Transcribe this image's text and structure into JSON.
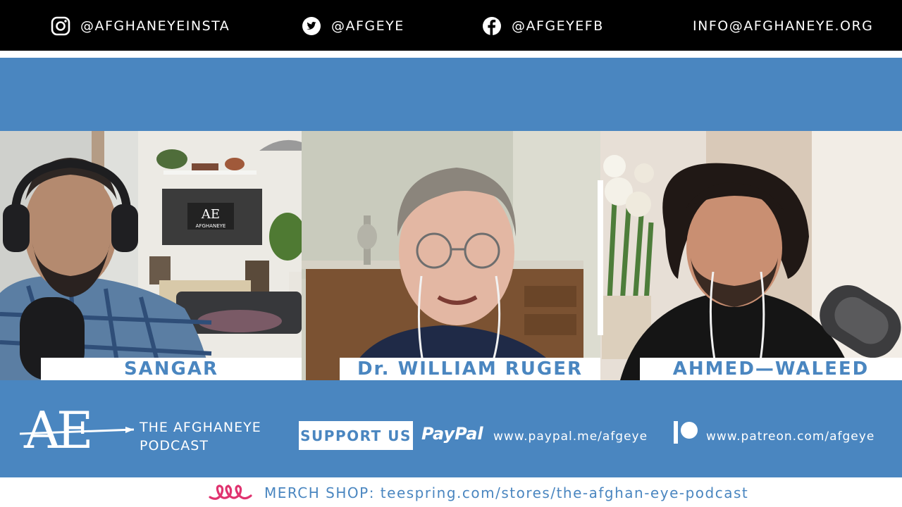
{
  "social": {
    "instagram": "@AFGHANEYEINSTA",
    "twitter": "@AFGEYE",
    "facebook": "@AFGEYEFB",
    "email": "INFO@AFGHANEYE.ORG"
  },
  "participants": [
    {
      "name": "SANGAR"
    },
    {
      "name": "Dr. WILLIAM RUGER"
    },
    {
      "name": "AHMED—WALEED"
    }
  ],
  "background_tv": {
    "logo": "AE",
    "label": "AFGHANEYE"
  },
  "banner": {
    "logo_text": "AE",
    "podcast_line1": "THE AFGHANEYE",
    "podcast_line2": "PODCAST",
    "support_label": "SUPPORT US",
    "paypal_label": "PayPal",
    "paypal_url": "www.paypal.me/afgeye",
    "patreon_url": "www.patreon.com/afgeye"
  },
  "merch": {
    "label": "MERCH SHOP:",
    "url": "teespring.com/stores/the-afghan-eye-podcast"
  },
  "colors": {
    "accent_blue": "#4a86c0",
    "bar_black": "#000000",
    "merch_pink": "#e0336f"
  },
  "icons": [
    "instagram-icon",
    "twitter-icon",
    "facebook-icon",
    "patreon-icon",
    "merch-icon"
  ]
}
